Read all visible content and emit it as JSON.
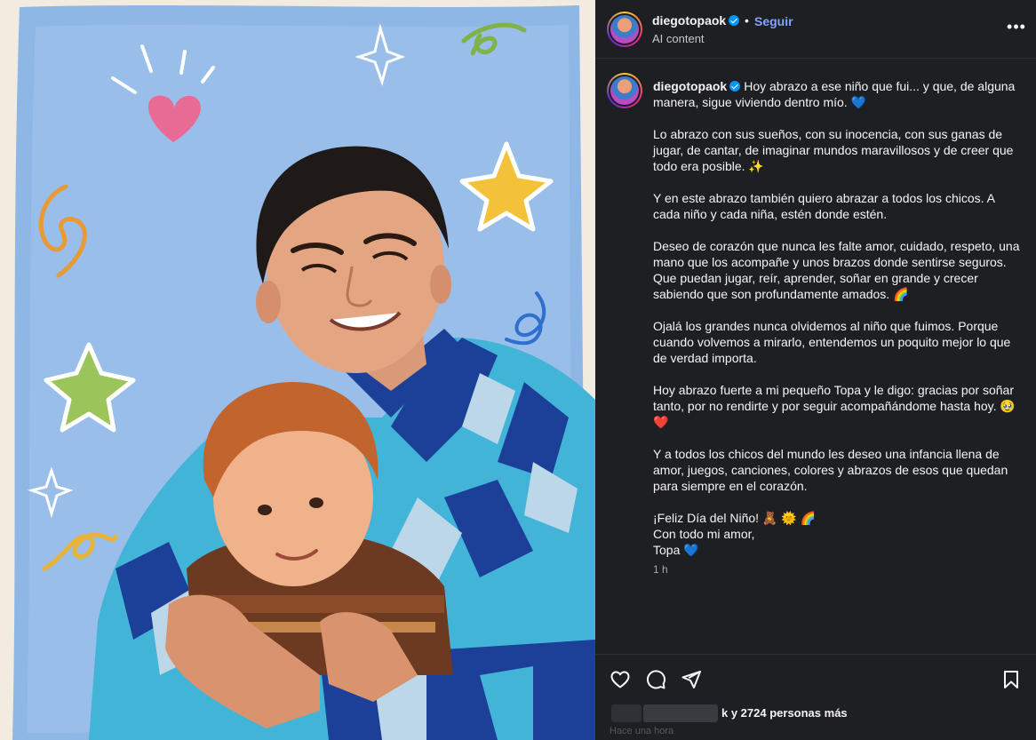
{
  "post": {
    "username": "diegotopaok",
    "follow_label": "Seguir",
    "separator": "•",
    "subtitle": "AI content",
    "more_label": "•••"
  },
  "caption": {
    "username": "diegotopaok",
    "paragraphs": [
      "Hoy abrazo a ese niño que fui... y que, de alguna manera, sigue viviendo dentro mío. 💙",
      "Lo abrazo con sus sueños, con su inocencia, con sus ganas de jugar, de cantar, de imaginar mundos maravillosos y de creer que todo era posible. ✨",
      "Y en este abrazo también quiero abrazar a todos los chicos. A cada niño y cada niña, estén donde estén.",
      "Deseo de corazón que nunca les falte amor, cuidado, respeto, una mano que los acompañe y unos brazos donde sentirse seguros. Que puedan jugar, reír, aprender, soñar en grande y crecer sabiendo que son profundamente amados. 🌈",
      "Ojalá los grandes nunca olvidemos al niño que fuimos. Porque cuando volvemos a mirarlo, entendemos un poquito mejor lo que de verdad importa.",
      "Hoy abrazo fuerte a mi pequeño Topa y le digo: gracias por soñar tanto, por no rendirte y por seguir acompañándome hasta hoy. 🥹 ❤️",
      "Y a todos los chicos del mundo les deseo una infancia llena de amor, juegos, canciones, colores y abrazos de esos que quedan para siempre en el corazón."
    ],
    "closing": [
      "¡Feliz Día del Niño! 🧸 🌞 🌈",
      "Con todo mi amor,",
      "Topa 💙"
    ],
    "time": "1 h"
  },
  "footer": {
    "likes_suffix": "k y 2724 personas más",
    "ago": "Hace una hora"
  },
  "icons": {
    "like": "heart-icon",
    "comment": "comment-icon",
    "share": "send-icon",
    "save": "bookmark-icon"
  },
  "colors": {
    "panel_bg": "#1e1f23",
    "link": "#85a1ff",
    "verified": "#0095f6",
    "sky": "#8fb7e6"
  }
}
